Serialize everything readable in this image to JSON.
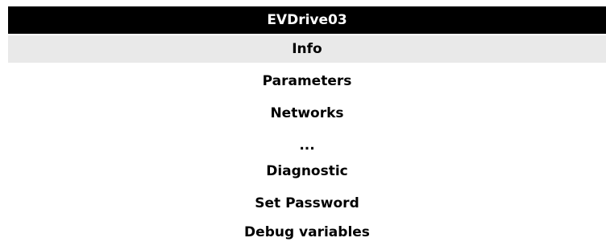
{
  "colors": {
    "title_bg": "#000000",
    "title_text": "#ffffff",
    "selected_bg": "#e9e9e9",
    "text": "#000000"
  },
  "menu": {
    "title": "EVDrive03",
    "items": [
      {
        "label": "Info",
        "selected": true
      },
      {
        "label": "Parameters",
        "selected": false
      },
      {
        "label": "Networks",
        "selected": false
      },
      {
        "label": "...",
        "selected": false
      },
      {
        "label": "Diagnostic",
        "selected": false
      },
      {
        "label": "Set Password",
        "selected": false
      },
      {
        "label": "Debug variables",
        "selected": false
      }
    ]
  }
}
